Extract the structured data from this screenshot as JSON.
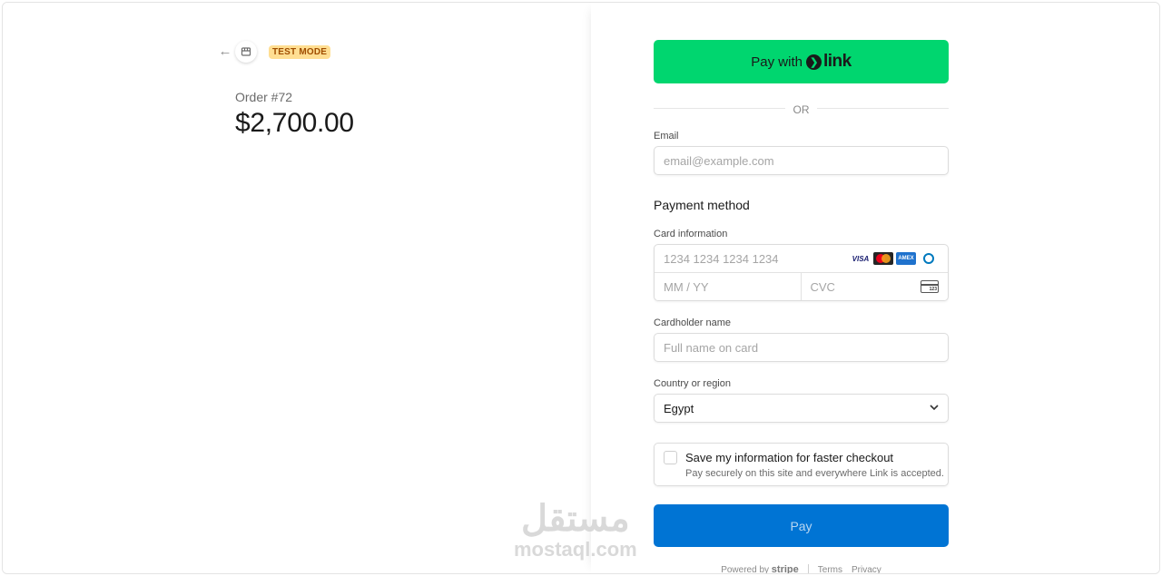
{
  "header": {
    "back_icon": "arrow-left-icon",
    "store_icon": "store-icon",
    "test_mode": "TEST MODE"
  },
  "order": {
    "label": "Order #72",
    "amount": "$2,700.00"
  },
  "link_button": {
    "prefix": "Pay with",
    "brand": "link"
  },
  "divider": {
    "text": "OR"
  },
  "email": {
    "label": "Email",
    "placeholder": "email@example.com"
  },
  "payment": {
    "title": "Payment method",
    "card_label": "Card information",
    "card_number_placeholder": "1234 1234 1234 1234",
    "expiry_placeholder": "MM / YY",
    "cvc_placeholder": "CVC",
    "brands": [
      "visa",
      "mastercard",
      "amex",
      "diners"
    ],
    "visa_text": "VISA",
    "amex_text": "AMEX",
    "cvc_icon_text": "123"
  },
  "cardholder": {
    "label": "Cardholder name",
    "placeholder": "Full name on card"
  },
  "country": {
    "label": "Country or region",
    "value": "Egypt"
  },
  "save_info": {
    "title": "Save my information for faster checkout",
    "subtitle": "Pay securely on this site and everywhere Link is accepted."
  },
  "pay_button": {
    "label": "Pay"
  },
  "footer": {
    "powered_by": "Powered by",
    "brand": "stripe",
    "terms": "Terms",
    "privacy": "Privacy"
  },
  "watermark": {
    "arabic": "مستقل",
    "latin": "mostaql.com"
  },
  "colors": {
    "link_green": "#00d66f",
    "pay_blue": "#0074d4",
    "test_badge_bg": "#ffde92",
    "test_badge_text": "#a04e00"
  }
}
